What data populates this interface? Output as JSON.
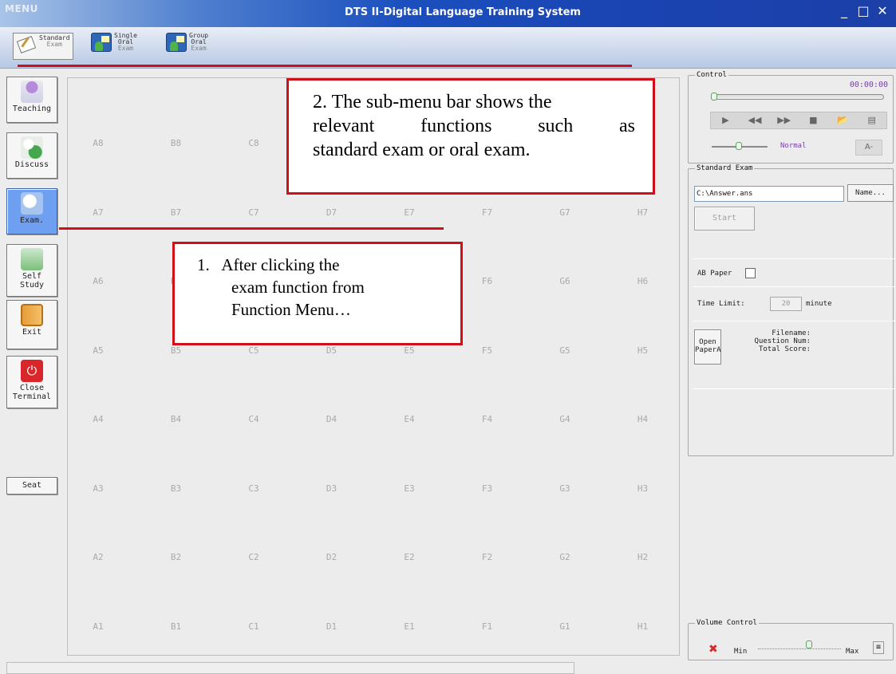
{
  "titlebar": {
    "menu": "MENU",
    "title": "DTS II-Digital Language Training System",
    "minimize": "_",
    "maximize": "□",
    "close": "✕"
  },
  "submenu": {
    "items": [
      {
        "line1": "Standard",
        "line2": "Exam",
        "icon": "book-icon"
      },
      {
        "line1": "Single",
        "line2": "Oral",
        "line3": "Exam",
        "icon": "oral-exam-icon"
      },
      {
        "line1": "Group",
        "line2": "Oral",
        "line3": "Exam",
        "icon": "group-oral-icon"
      }
    ]
  },
  "sidebar": {
    "items": [
      {
        "label": "Teaching",
        "icon": "teacher-icon"
      },
      {
        "label": "Discuss",
        "icon": "discuss-icon"
      },
      {
        "label": "Exam.",
        "icon": "exam-icon"
      },
      {
        "label": "Self",
        "label2": "Study",
        "icon": "self-study-icon"
      },
      {
        "label": "Exit",
        "icon": "door-icon"
      },
      {
        "label": "Close",
        "label2": "Terminal",
        "icon": "power-icon"
      }
    ],
    "seat": "Seat"
  },
  "grid": {
    "columns": [
      "A",
      "B",
      "C",
      "D",
      "E",
      "F",
      "G",
      "H"
    ],
    "rows": [
      8,
      7,
      6,
      5,
      4,
      3,
      2,
      1
    ]
  },
  "control": {
    "legend": "Control",
    "time": "00:00:00",
    "speed": "Normal",
    "font_btn": "A-",
    "transport": [
      "▶",
      "◀◀",
      "▶▶",
      "■",
      "📂",
      "▤"
    ]
  },
  "standard_exam": {
    "legend": "Standard Exam",
    "path": "C:\\Answer.ans",
    "name_btn": "Name...",
    "start_btn": "Start",
    "ab_paper": "AB Paper",
    "time_limit_label": "Time Limit:",
    "time_limit_value": "20",
    "time_limit_unit": "minute",
    "open_btn_line1": "Open",
    "open_btn_line2": "PaperA",
    "filename": "Filename:",
    "question_num": "Question Num:",
    "total_score": "Total Score:"
  },
  "volume": {
    "legend": "Volume Control",
    "min": "Min",
    "max": "Max"
  },
  "annotations": {
    "callout2": [
      "2. The sub-menu bar shows the",
      "relevant functions such as",
      "standard exam or oral exam."
    ],
    "callout1": [
      "1.   After clicking the",
      "exam function from",
      "Function Menu…"
    ]
  }
}
